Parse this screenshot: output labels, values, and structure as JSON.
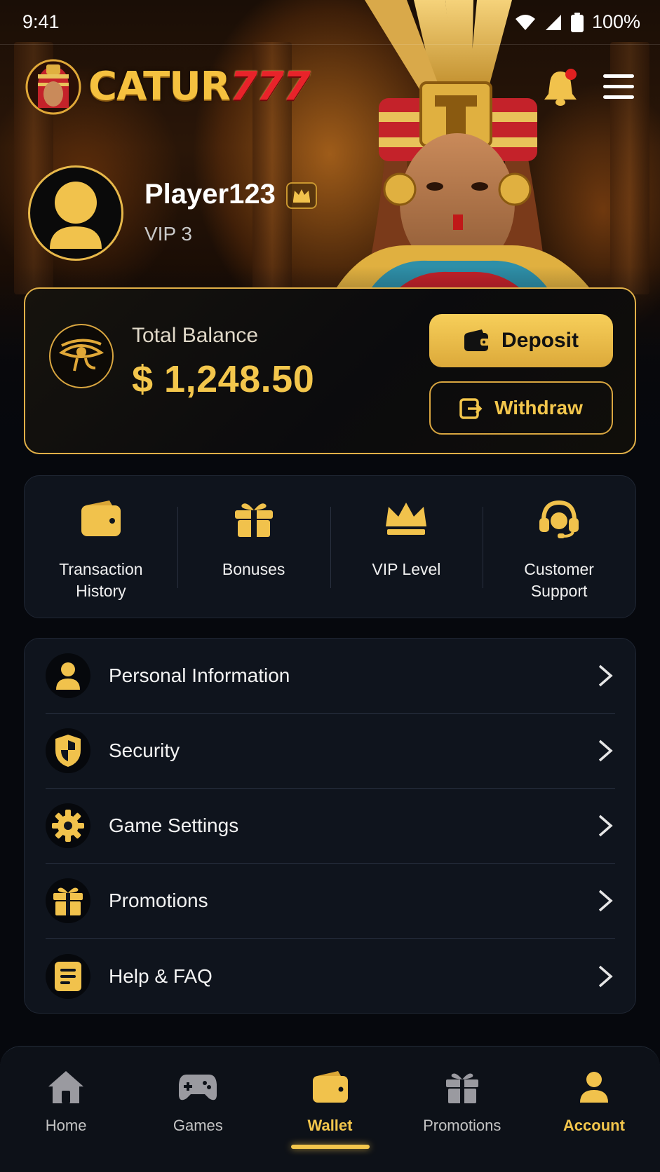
{
  "status_bar": {
    "time": "9:41",
    "battery": "100%"
  },
  "header": {
    "logo_text_main": "CATUR",
    "logo_text_number": "777",
    "has_notification": true
  },
  "profile": {
    "username": "Player123",
    "vip_level": "VIP 3"
  },
  "balance": {
    "label": "Total Balance",
    "amount": "$ 1,248.50",
    "deposit_label": "Deposit",
    "withdraw_label": "Withdraw"
  },
  "quick_actions": [
    {
      "label_line1": "Transaction",
      "label_line2": "History",
      "icon": "wallet-icon"
    },
    {
      "label_line1": "Bonuses",
      "label_line2": "",
      "icon": "gift-icon"
    },
    {
      "label_line1": "VIP Level",
      "label_line2": "",
      "icon": "crown-icon"
    },
    {
      "label_line1": "Customer",
      "label_line2": "Support",
      "icon": "headset-icon"
    }
  ],
  "menu": [
    {
      "label": "Personal Information",
      "icon": "user-icon"
    },
    {
      "label": "Security",
      "icon": "shield-icon"
    },
    {
      "label": "Game Settings",
      "icon": "gear-icon"
    },
    {
      "label": "Promotions",
      "icon": "gift-icon"
    },
    {
      "label": "Help & FAQ",
      "icon": "document-icon"
    }
  ],
  "bottom_nav": [
    {
      "label": "Home",
      "icon": "home-icon"
    },
    {
      "label": "Games",
      "icon": "gamepad-icon"
    },
    {
      "label": "Wallet",
      "icon": "wallet-icon",
      "active": true
    },
    {
      "label": "Promotions",
      "icon": "gift-icon"
    },
    {
      "label": "Account",
      "icon": "user-icon",
      "highlighted": true
    }
  ],
  "colors": {
    "accent_gold": "#f3c64c",
    "logo_red": "#e8232a",
    "background": "#06080d",
    "card": "#0f141d"
  }
}
